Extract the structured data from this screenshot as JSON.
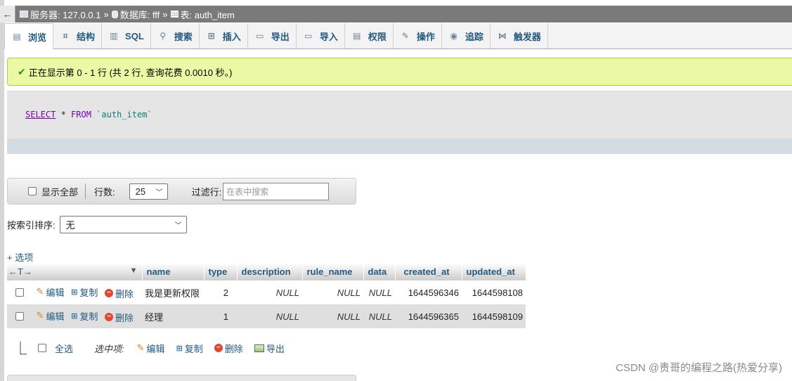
{
  "breadcrumb": {
    "back": "←",
    "server": "服务器: 127.0.0.1",
    "sep1": "»",
    "database": "数据库: fff",
    "sep2": "»",
    "table": "表: auth_item"
  },
  "tabs": [
    {
      "label": "浏览",
      "icon": "browse-icon",
      "glyph": "▤"
    },
    {
      "label": "结构",
      "icon": "structure-icon",
      "glyph": "⌗"
    },
    {
      "label": "SQL",
      "icon": "sql-icon",
      "glyph": "▥"
    },
    {
      "label": "搜索",
      "icon": "search-icon",
      "glyph": "⚲"
    },
    {
      "label": "插入",
      "icon": "insert-icon",
      "glyph": "⊞"
    },
    {
      "label": "导出",
      "icon": "export-icon",
      "glyph": "▭"
    },
    {
      "label": "导入",
      "icon": "import-icon",
      "glyph": "▭"
    },
    {
      "label": "权限",
      "icon": "privileges-icon",
      "glyph": "▤"
    },
    {
      "label": "操作",
      "icon": "wrench-icon",
      "glyph": "✎"
    },
    {
      "label": "追踪",
      "icon": "eye-icon",
      "glyph": "◉"
    },
    {
      "label": "触发器",
      "icon": "triggers-icon",
      "glyph": "⋈"
    }
  ],
  "message": {
    "check": "✔",
    "text": "正在显示第 0 - 1 行 (共 2 行, 查询花费 0.0010 秒。)"
  },
  "sql": {
    "select": "SELECT",
    "rest": " * ",
    "from": "FROM",
    "table": " `auth_item`"
  },
  "navigation": {
    "show_all": "显示全部",
    "rows_label": "行数:",
    "rows_value": "25",
    "filter_label": "过滤行:",
    "filter_placeholder": "在表中搜索"
  },
  "sort": {
    "label": "按索引排序:",
    "value": "无"
  },
  "options_link": "+ 选项",
  "table": {
    "columns": [
      "name",
      "type",
      "description",
      "rule_name",
      "data",
      "created_at",
      "updated_at"
    ],
    "sort_arrows": "←T→",
    "sort_caret": "▼",
    "actions": {
      "edit": "编辑",
      "copy": "复制",
      "delete": "删除"
    },
    "rows": [
      {
        "name": "我是更新权限",
        "type": "2",
        "description": "NULL",
        "rule_name": "NULL",
        "data": "NULL",
        "created_at": "1644596346",
        "updated_at": "1644598108"
      },
      {
        "name": "经理",
        "type": "1",
        "description": "NULL",
        "rule_name": "NULL",
        "data": "NULL",
        "created_at": "1644596365",
        "updated_at": "1644598109"
      }
    ]
  },
  "bulk": {
    "arrow": "⎿",
    "select_all": "全选",
    "with_selected": "选中项:",
    "edit": "编辑",
    "copy": "复制",
    "delete": "删除",
    "export": "导出"
  },
  "watermark": "CSDN @贵哥的编程之路(热爱分享)"
}
